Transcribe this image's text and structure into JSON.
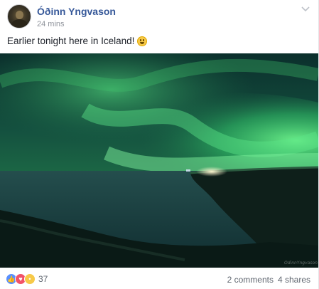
{
  "post": {
    "author": "Óðinn Yngvason",
    "timestamp": "24 mins",
    "caption": "Earlier tonight here in Iceland!",
    "photo_watermark": "OdinnYngvason",
    "reactions": {
      "types": [
        "like-icon",
        "love-icon",
        "wow-icon"
      ],
      "count": "37"
    },
    "comments": "2 comments",
    "shares": "4 shares"
  },
  "colors": {
    "author_link": "#365899",
    "meta_text": "#90949c",
    "aurora_green": "#3fe06a",
    "like": "#5890ff",
    "love": "#f25268",
    "wow": "#f7c948"
  }
}
